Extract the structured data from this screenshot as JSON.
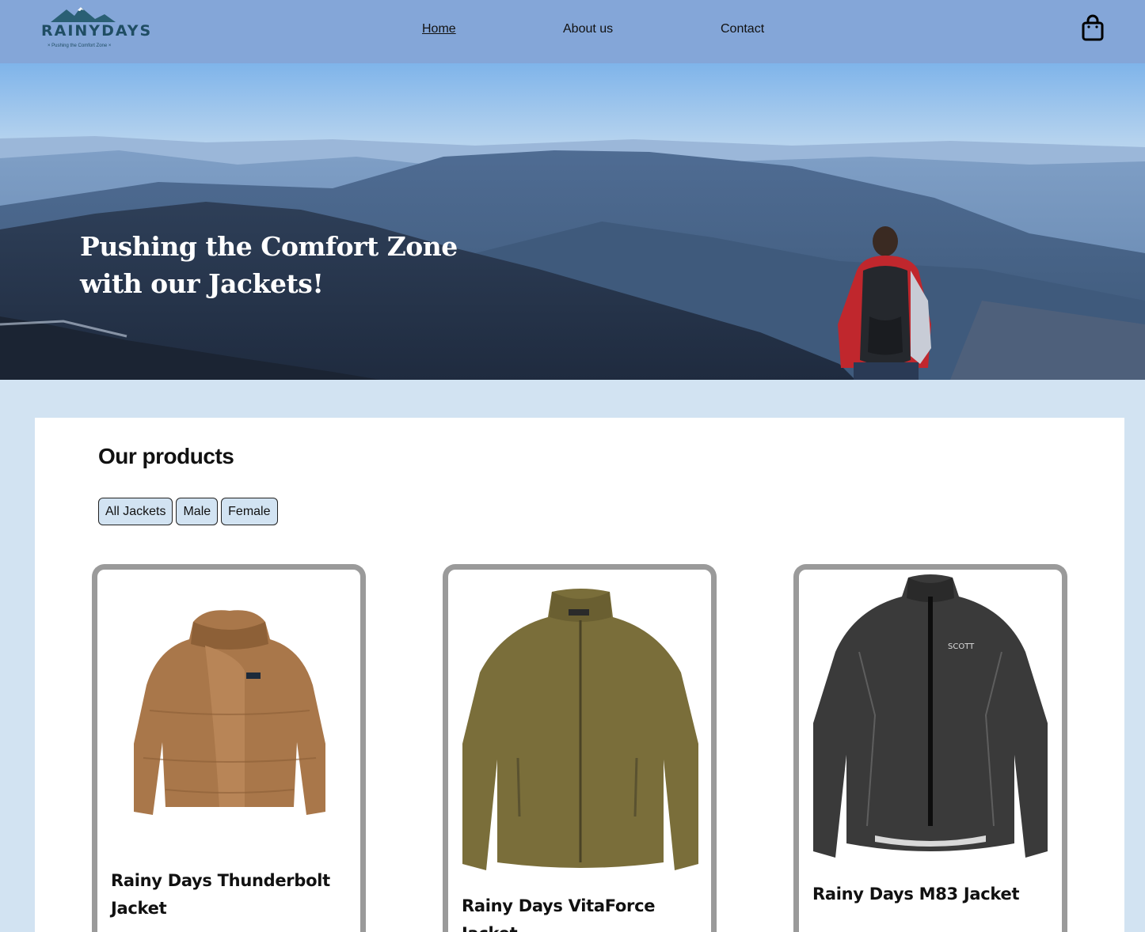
{
  "header": {
    "logo_text": "RAINYDAYS",
    "logo_tagline": "Pushing the Comfort Zone",
    "nav": [
      {
        "label": "Home",
        "active": true
      },
      {
        "label": "About us",
        "active": false
      },
      {
        "label": "Contact",
        "active": false
      }
    ],
    "cart_icon": "shopping-bag-icon"
  },
  "hero": {
    "title": "Pushing the Comfort Zone with our Jackets!"
  },
  "products": {
    "title": "Our products",
    "filters": [
      "All Jackets",
      "Male",
      "Female"
    ],
    "items": [
      {
        "name": "Rainy Days Thunderbolt Jacket",
        "color": "#a9774a"
      },
      {
        "name": "Rainy Days VitaForce Jacket",
        "color": "#7a6e3a"
      },
      {
        "name": "Rainy Days M83 Jacket",
        "color": "#3a3a3a"
      }
    ]
  },
  "colors": {
    "header_bg": "#84a6d8",
    "page_bg": "#d2e3f2",
    "card_border": "#9a9a9a"
  }
}
